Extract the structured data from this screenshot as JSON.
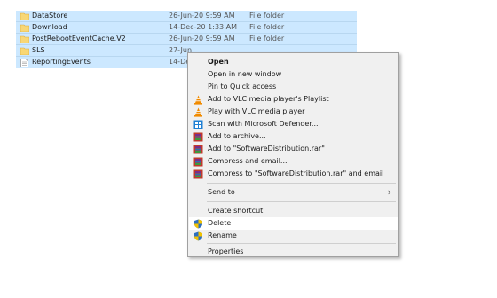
{
  "files": [
    {
      "name": "DataStore",
      "date": "26-Jun-20 9:59 AM",
      "type": "File folder",
      "icon": "folder-icon"
    },
    {
      "name": "Download",
      "date": "14-Dec-20 1:33 AM",
      "type": "File folder",
      "icon": "folder-icon"
    },
    {
      "name": "PostRebootEventCache.V2",
      "date": "26-Jun-20 9:59 AM",
      "type": "File folder",
      "icon": "folder-icon"
    },
    {
      "name": "SLS",
      "date": "27-Jun",
      "type": "",
      "icon": "folder-icon"
    },
    {
      "name": "ReportingEvents",
      "date": "14-Dec",
      "type": "",
      "icon": "text-file-icon"
    }
  ],
  "context_menu": {
    "open": "Open",
    "open_new_window": "Open in new window",
    "pin_quick_access": "Pin to Quick access",
    "vlc_playlist": "Add to VLC media player's Playlist",
    "vlc_play": "Play with VLC media player",
    "defender_scan": "Scan with Microsoft Defender...",
    "add_archive": "Add to archive...",
    "add_rar": "Add to \"SoftwareDistribution.rar\"",
    "compress_email": "Compress and email...",
    "compress_rar_email": "Compress to \"SoftwareDistribution.rar\" and email",
    "send_to": "Send to",
    "create_shortcut": "Create shortcut",
    "delete": "Delete",
    "rename": "Rename",
    "properties": "Properties"
  },
  "colors": {
    "selection": "#cce8ff",
    "menu_bg": "#f0f0f0",
    "hover": "#ffffff",
    "folder": "#f8d775",
    "vlc_orange": "#f08a00",
    "winrar_red": "#c0392b"
  }
}
